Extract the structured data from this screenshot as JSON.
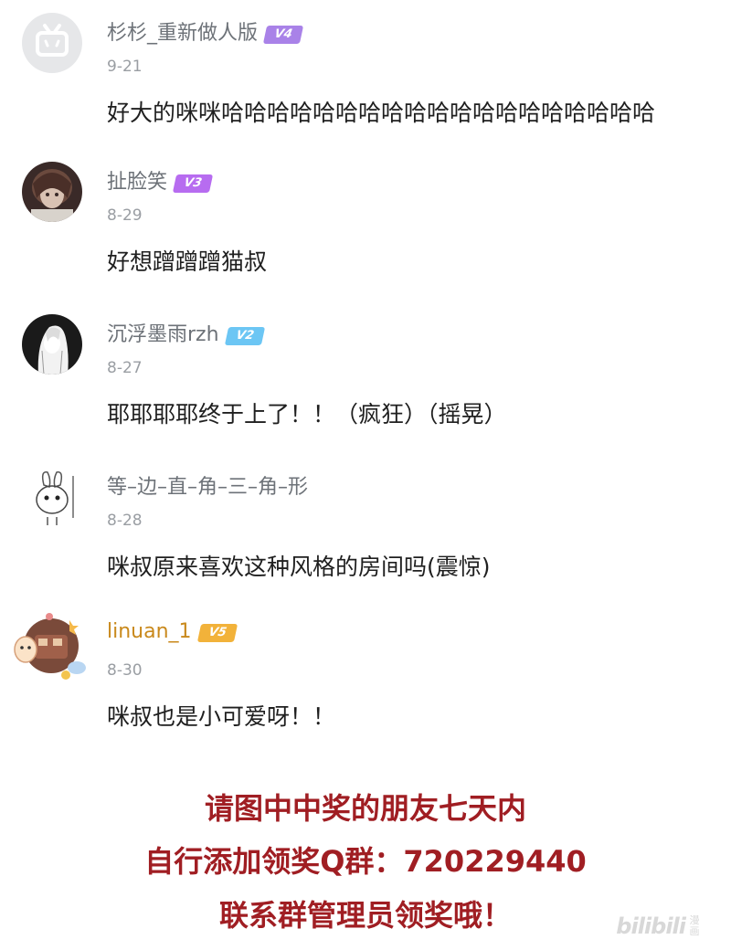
{
  "comments": [
    {
      "username": "杉杉_重新做人版",
      "level": "V4",
      "level_color": "#a982e8",
      "date": "9-21",
      "text": "好大的咪咪哈哈哈哈哈哈哈哈哈哈哈哈哈哈哈哈哈哈哈"
    },
    {
      "username": "扯脸笑",
      "level": "V3",
      "level_color": "#b76cf0",
      "date": "8-29",
      "text": "好想蹭蹭蹭猫叔"
    },
    {
      "username": "沉浮墨雨rzh",
      "level": "V2",
      "level_color": "#6cc6f4",
      "date": "8-27",
      "text": "耶耶耶耶终于上了！！（疯狂）（摇晃）"
    },
    {
      "username": "等–边–直–角–三–角–形",
      "level": "",
      "level_color": "",
      "date": "8-28",
      "text": "咪叔原来喜欢这种风格的房间吗(震惊)"
    },
    {
      "username": "linuan_1",
      "level": "V5",
      "level_color": "#f2b23a",
      "date": "8-30",
      "text": "咪叔也是小可爱呀！！"
    }
  ],
  "notice": {
    "line1": "请图中中奖的朋友七天内",
    "line2": "自行添加领奖Q群：720229440",
    "line3": "联系群管理员领奖哦！",
    "color": "#a01e23"
  },
  "watermark": {
    "logo": "bilibili",
    "side": "漫画"
  }
}
